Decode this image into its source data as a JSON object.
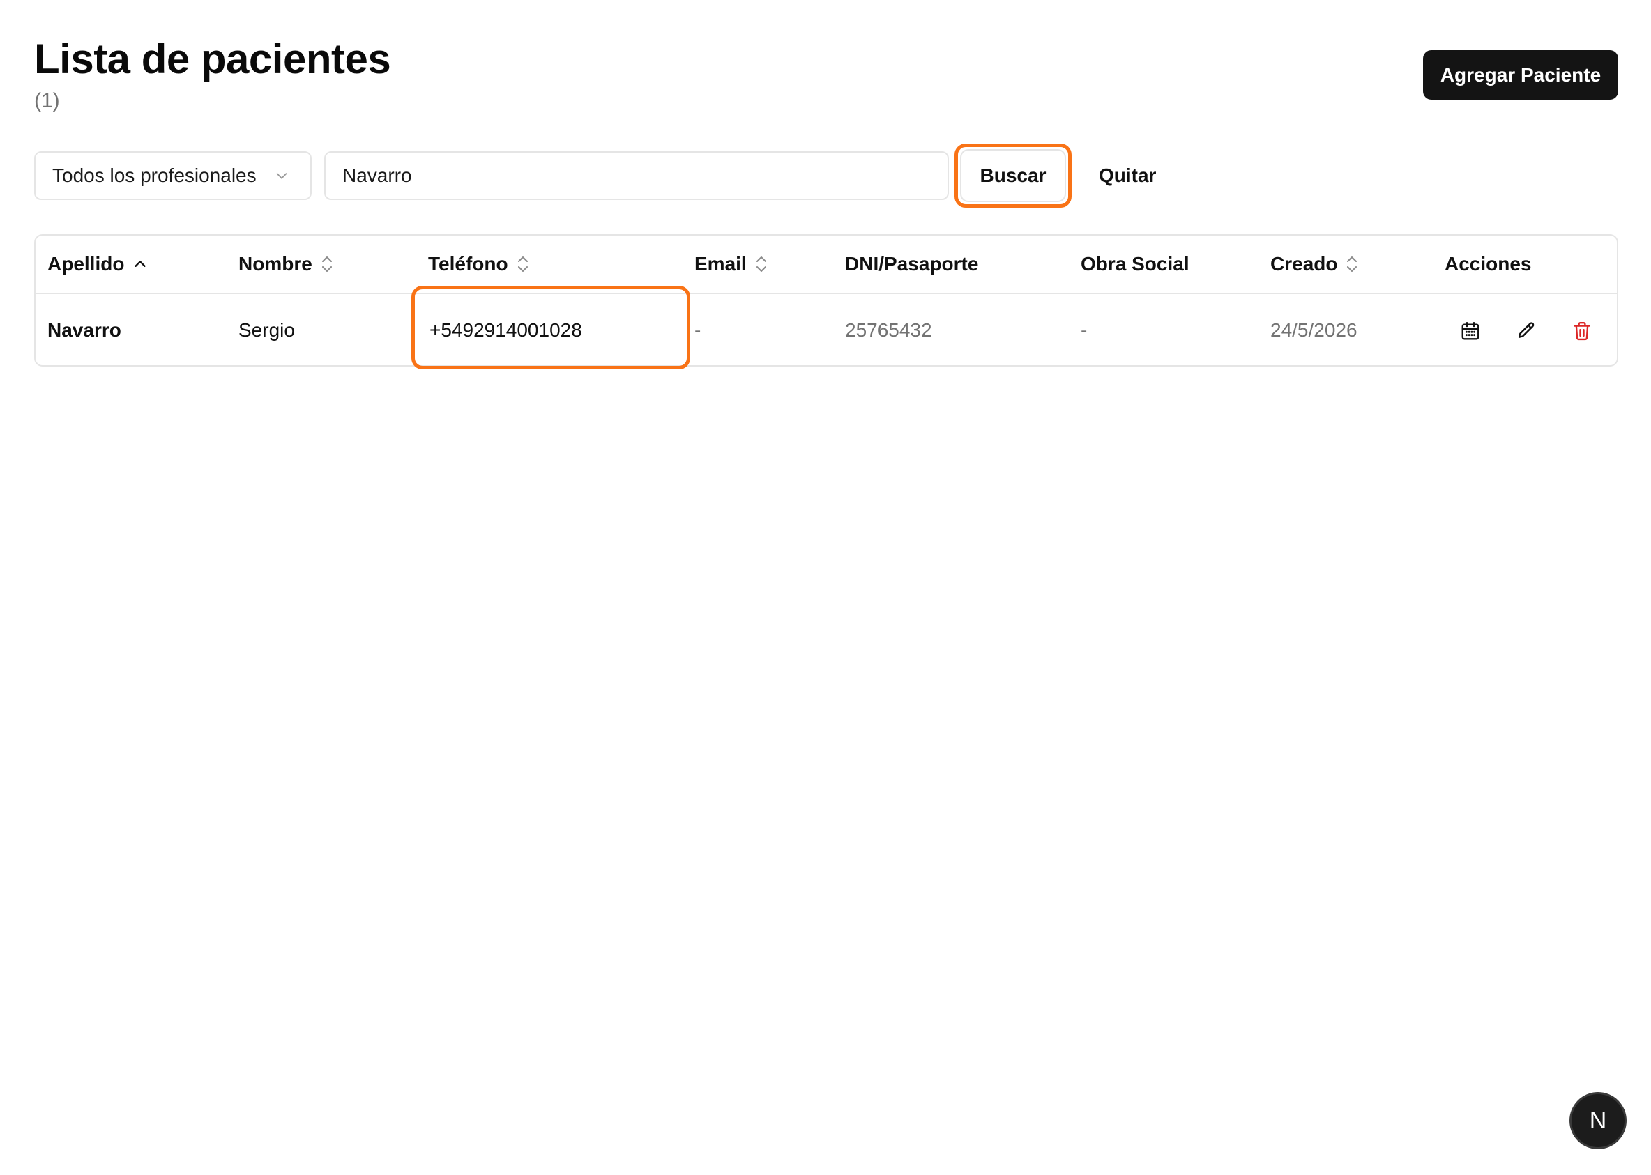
{
  "header": {
    "title": "Lista de pacientes",
    "count": "(1)",
    "add_button": "Agregar Paciente"
  },
  "filters": {
    "professional_select": "Todos los profesionales",
    "search_value": "Navarro",
    "search_button": "Buscar",
    "clear_button": "Quitar"
  },
  "table": {
    "columns": [
      {
        "label": "Apellido",
        "sort": "ascending"
      },
      {
        "label": "Nombre",
        "sort": "sortable"
      },
      {
        "label": "Teléfono",
        "sort": "sortable"
      },
      {
        "label": "Email",
        "sort": "sortable"
      },
      {
        "label": "DNI/Pasaporte",
        "sort": "none"
      },
      {
        "label": "Obra Social",
        "sort": "none"
      },
      {
        "label": "Creado",
        "sort": "sortable"
      },
      {
        "label": "Acciones",
        "sort": "none"
      }
    ],
    "rows": [
      {
        "apellido": "Navarro",
        "nombre": "Sergio",
        "telefono": "+5492914001028",
        "email": "-",
        "dni": "25765432",
        "obra_social": "-",
        "creado": "24/5/2026",
        "actions": [
          "calendar-icon",
          "pencil-icon",
          "trash-icon"
        ]
      }
    ]
  },
  "colors": {
    "highlight": "#f97316",
    "primary_button": "#141414",
    "danger": "#dc2626",
    "muted_text": "#737373",
    "border": "#e5e5e5"
  },
  "dev_badge": "N"
}
